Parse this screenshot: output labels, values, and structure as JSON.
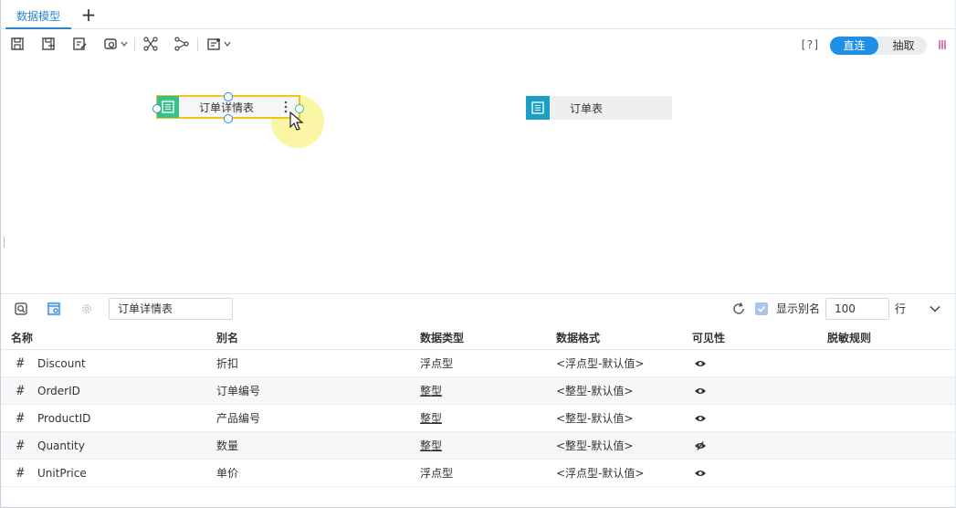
{
  "tabs": {
    "active_label": "数据模型",
    "add_label": "+"
  },
  "toolbar": {
    "help_label": "[?]",
    "mode_direct": "直连",
    "mode_extract": "抽取",
    "icons": [
      "save-icon",
      "save-as-icon",
      "edit-icon",
      "settings-dropdown-icon",
      "relation-icon",
      "auto-relation-icon",
      "preview-dropdown-icon"
    ]
  },
  "canvas": {
    "nodes": [
      {
        "label": "订单详情表",
        "selected": true
      },
      {
        "label": "订单表",
        "selected": false
      }
    ]
  },
  "panel": {
    "table_name": "订单详情表",
    "show_alias_label": "显示别名",
    "show_alias_checked": true,
    "row_count": "100",
    "row_unit": "行"
  },
  "table": {
    "headers": [
      "名称",
      "别名",
      "数据类型",
      "数据格式",
      "可见性",
      "脱敏规则"
    ],
    "rows": [
      {
        "name": "Discount",
        "alias": "折扣",
        "type": "浮点型",
        "format": "<浮点型-默认值>",
        "visible": true
      },
      {
        "name": "OrderID",
        "alias": "订单编号",
        "type": "整型",
        "format": "<整型-默认值>",
        "visible": true
      },
      {
        "name": "ProductID",
        "alias": "产品编号",
        "type": "整型",
        "format": "<整型-默认值>",
        "visible": true
      },
      {
        "name": "Quantity",
        "alias": "数量",
        "type": "整型",
        "format": "<整型-默认值>",
        "visible": false
      },
      {
        "name": "UnitPrice",
        "alias": "单价",
        "type": "浮点型",
        "format": "<浮点型-默认值>",
        "visible": true
      }
    ]
  },
  "colors": {
    "accent": "#1e8fe6",
    "selected_node_border": "#f0c419",
    "node_green": "#3bbf8b",
    "node_teal": "#1b9fc5"
  }
}
